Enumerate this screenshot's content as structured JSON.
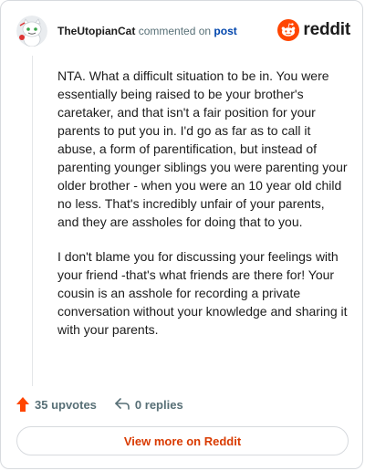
{
  "header": {
    "username": "TheUtopianCat",
    "action_text": "commented on",
    "post_link": "post",
    "brand": "reddit"
  },
  "comment": {
    "paragraphs": [
      "NTA. What a difficult situation to be in. You were essentially being raised to be your brother's caretaker, and that isn't a fair position for your parents to put you in. I'd go as far as to call it abuse, a form of parentification, but instead of parenting younger siblings you were parenting your older brother - when you were an 10 year old child no less. That's incredibly unfair of your parents, and they are assholes for doing that to you.",
      "I don't blame you for discussing your feelings with your friend -that's what friends are there for! Your cousin is an asshole for recording a private conversation without your knowledge and sharing it with your parents."
    ]
  },
  "footer": {
    "upvotes": "35 upvotes",
    "replies": "0 replies",
    "view_more": "View more on Reddit"
  },
  "colors": {
    "brand_orange": "#ff4500",
    "upvote_orange": "#ff4500",
    "link_blue": "#0045ac",
    "view_more_text": "#d93a00"
  },
  "icons": {
    "avatar": "snoo-avatar-icon",
    "logo": "reddit-logo-icon",
    "upvote": "upvote-arrow-icon",
    "reply": "reply-arrow-icon"
  }
}
